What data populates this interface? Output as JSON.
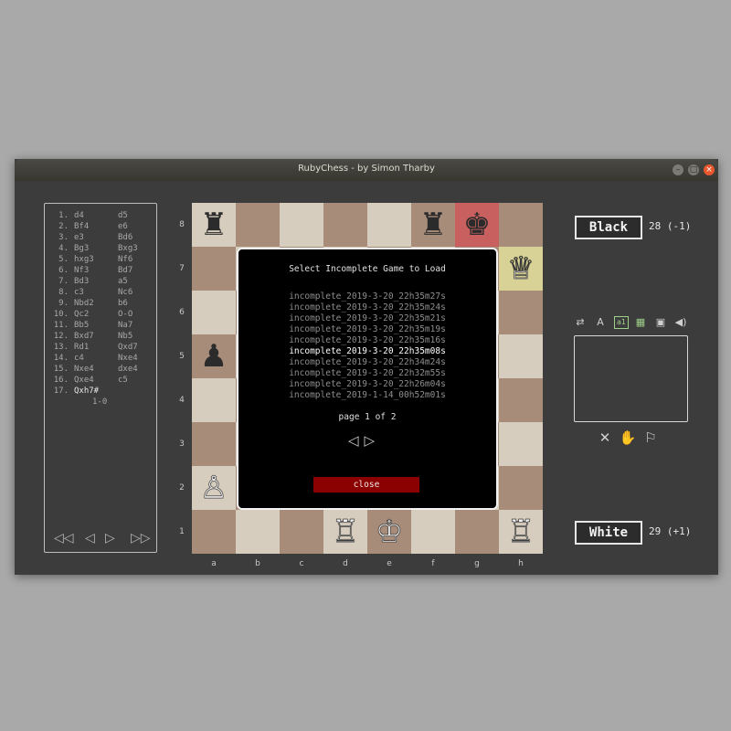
{
  "window": {
    "title": "RubyChess - by Simon Tharby"
  },
  "moves": {
    "rows": [
      {
        "num": "1.",
        "w": "d4",
        "b": "d5"
      },
      {
        "num": "2.",
        "w": "Bf4",
        "b": "e6"
      },
      {
        "num": "3.",
        "w": "e3",
        "b": "Bd6"
      },
      {
        "num": "4.",
        "w": "Bg3",
        "b": "Bxg3"
      },
      {
        "num": "5.",
        "w": "hxg3",
        "b": "Nf6"
      },
      {
        "num": "6.",
        "w": "Nf3",
        "b": "Bd7"
      },
      {
        "num": "7.",
        "w": "Bd3",
        "b": "a5"
      },
      {
        "num": "8.",
        "w": "c3",
        "b": "Nc6"
      },
      {
        "num": "9.",
        "w": "Nbd2",
        "b": "b6"
      },
      {
        "num": "10.",
        "w": "Qc2",
        "b": "O-O"
      },
      {
        "num": "11.",
        "w": "Bb5",
        "b": "Na7"
      },
      {
        "num": "12.",
        "w": "Bxd7",
        "b": "Nb5"
      },
      {
        "num": "13.",
        "w": "Rd1",
        "b": "Qxd7"
      },
      {
        "num": "14.",
        "w": "c4",
        "b": "Nxe4"
      },
      {
        "num": "15.",
        "w": "Nxe4",
        "b": "dxe4"
      },
      {
        "num": "16.",
        "w": "Qxe4",
        "b": "c5"
      },
      {
        "num": "17.",
        "w": "Qxh7#",
        "b": ""
      }
    ],
    "result": "1-0",
    "nav": {
      "first": "◁◁",
      "prev": "◁",
      "next": "▷",
      "last": "▷▷"
    }
  },
  "board": {
    "ranks": [
      "8",
      "7",
      "6",
      "5",
      "4",
      "3",
      "2",
      "1"
    ],
    "files": [
      "a",
      "b",
      "c",
      "d",
      "e",
      "f",
      "g",
      "h"
    ],
    "highlight_colors": {
      "check": "#c86060",
      "last_move": "#d8d296"
    },
    "pieces": [
      {
        "square": "a8",
        "glyph": "♜",
        "color": "black"
      },
      {
        "square": "f8",
        "glyph": "♜",
        "color": "black"
      },
      {
        "square": "g8",
        "glyph": "♚",
        "color": "black"
      },
      {
        "square": "h7",
        "glyph": "♕",
        "color": "white"
      },
      {
        "square": "a5",
        "glyph": "♟",
        "color": "black"
      },
      {
        "square": "a2",
        "glyph": "♙",
        "color": "white"
      },
      {
        "square": "d1",
        "glyph": "♖",
        "color": "white"
      },
      {
        "square": "e1",
        "glyph": "♔",
        "color": "white"
      },
      {
        "square": "h1",
        "glyph": "♖",
        "color": "white"
      }
    ]
  },
  "dialog": {
    "title": "Select Incomplete Game to Load",
    "files": [
      "incomplete_2019-3-20_22h35m27s",
      "incomplete_2019-3-20_22h35m24s",
      "incomplete_2019-3-20_22h35m21s",
      "incomplete_2019-3-20_22h35m19s",
      "incomplete_2019-3-20_22h35m16s",
      "incomplete_2019-3-20_22h35m08s",
      "incomplete_2019-3-20_22h34m24s",
      "incomplete_2019-3-20_22h32m55s",
      "incomplete_2019-3-20_22h26m04s",
      "incomplete_2019-1-14_00h52m01s"
    ],
    "selected_index": 5,
    "page_text": "page 1 of 2",
    "prev_arrow": "◁",
    "next_arrow": "▷",
    "close_label": "close"
  },
  "players": {
    "black": {
      "name": "Black",
      "score": "28 (-1)"
    },
    "white": {
      "name": "White",
      "score": "29 (+1)"
    }
  },
  "tools": [
    {
      "icon": "flip-board-icon",
      "glyph": "⇄"
    },
    {
      "icon": "font-size-icon",
      "glyph": "A"
    },
    {
      "icon": "coordinates-icon",
      "glyph": "a1"
    },
    {
      "icon": "board-theme-icon",
      "glyph": "▦"
    },
    {
      "icon": "save-icon",
      "glyph": "▣"
    },
    {
      "icon": "sound-icon",
      "glyph": "◀)"
    }
  ],
  "actions": [
    {
      "icon": "resign-swords-icon",
      "glyph": "✕"
    },
    {
      "icon": "offer-draw-hand-icon",
      "glyph": "✋"
    },
    {
      "icon": "surrender-flag-icon",
      "glyph": "⚐"
    }
  ]
}
